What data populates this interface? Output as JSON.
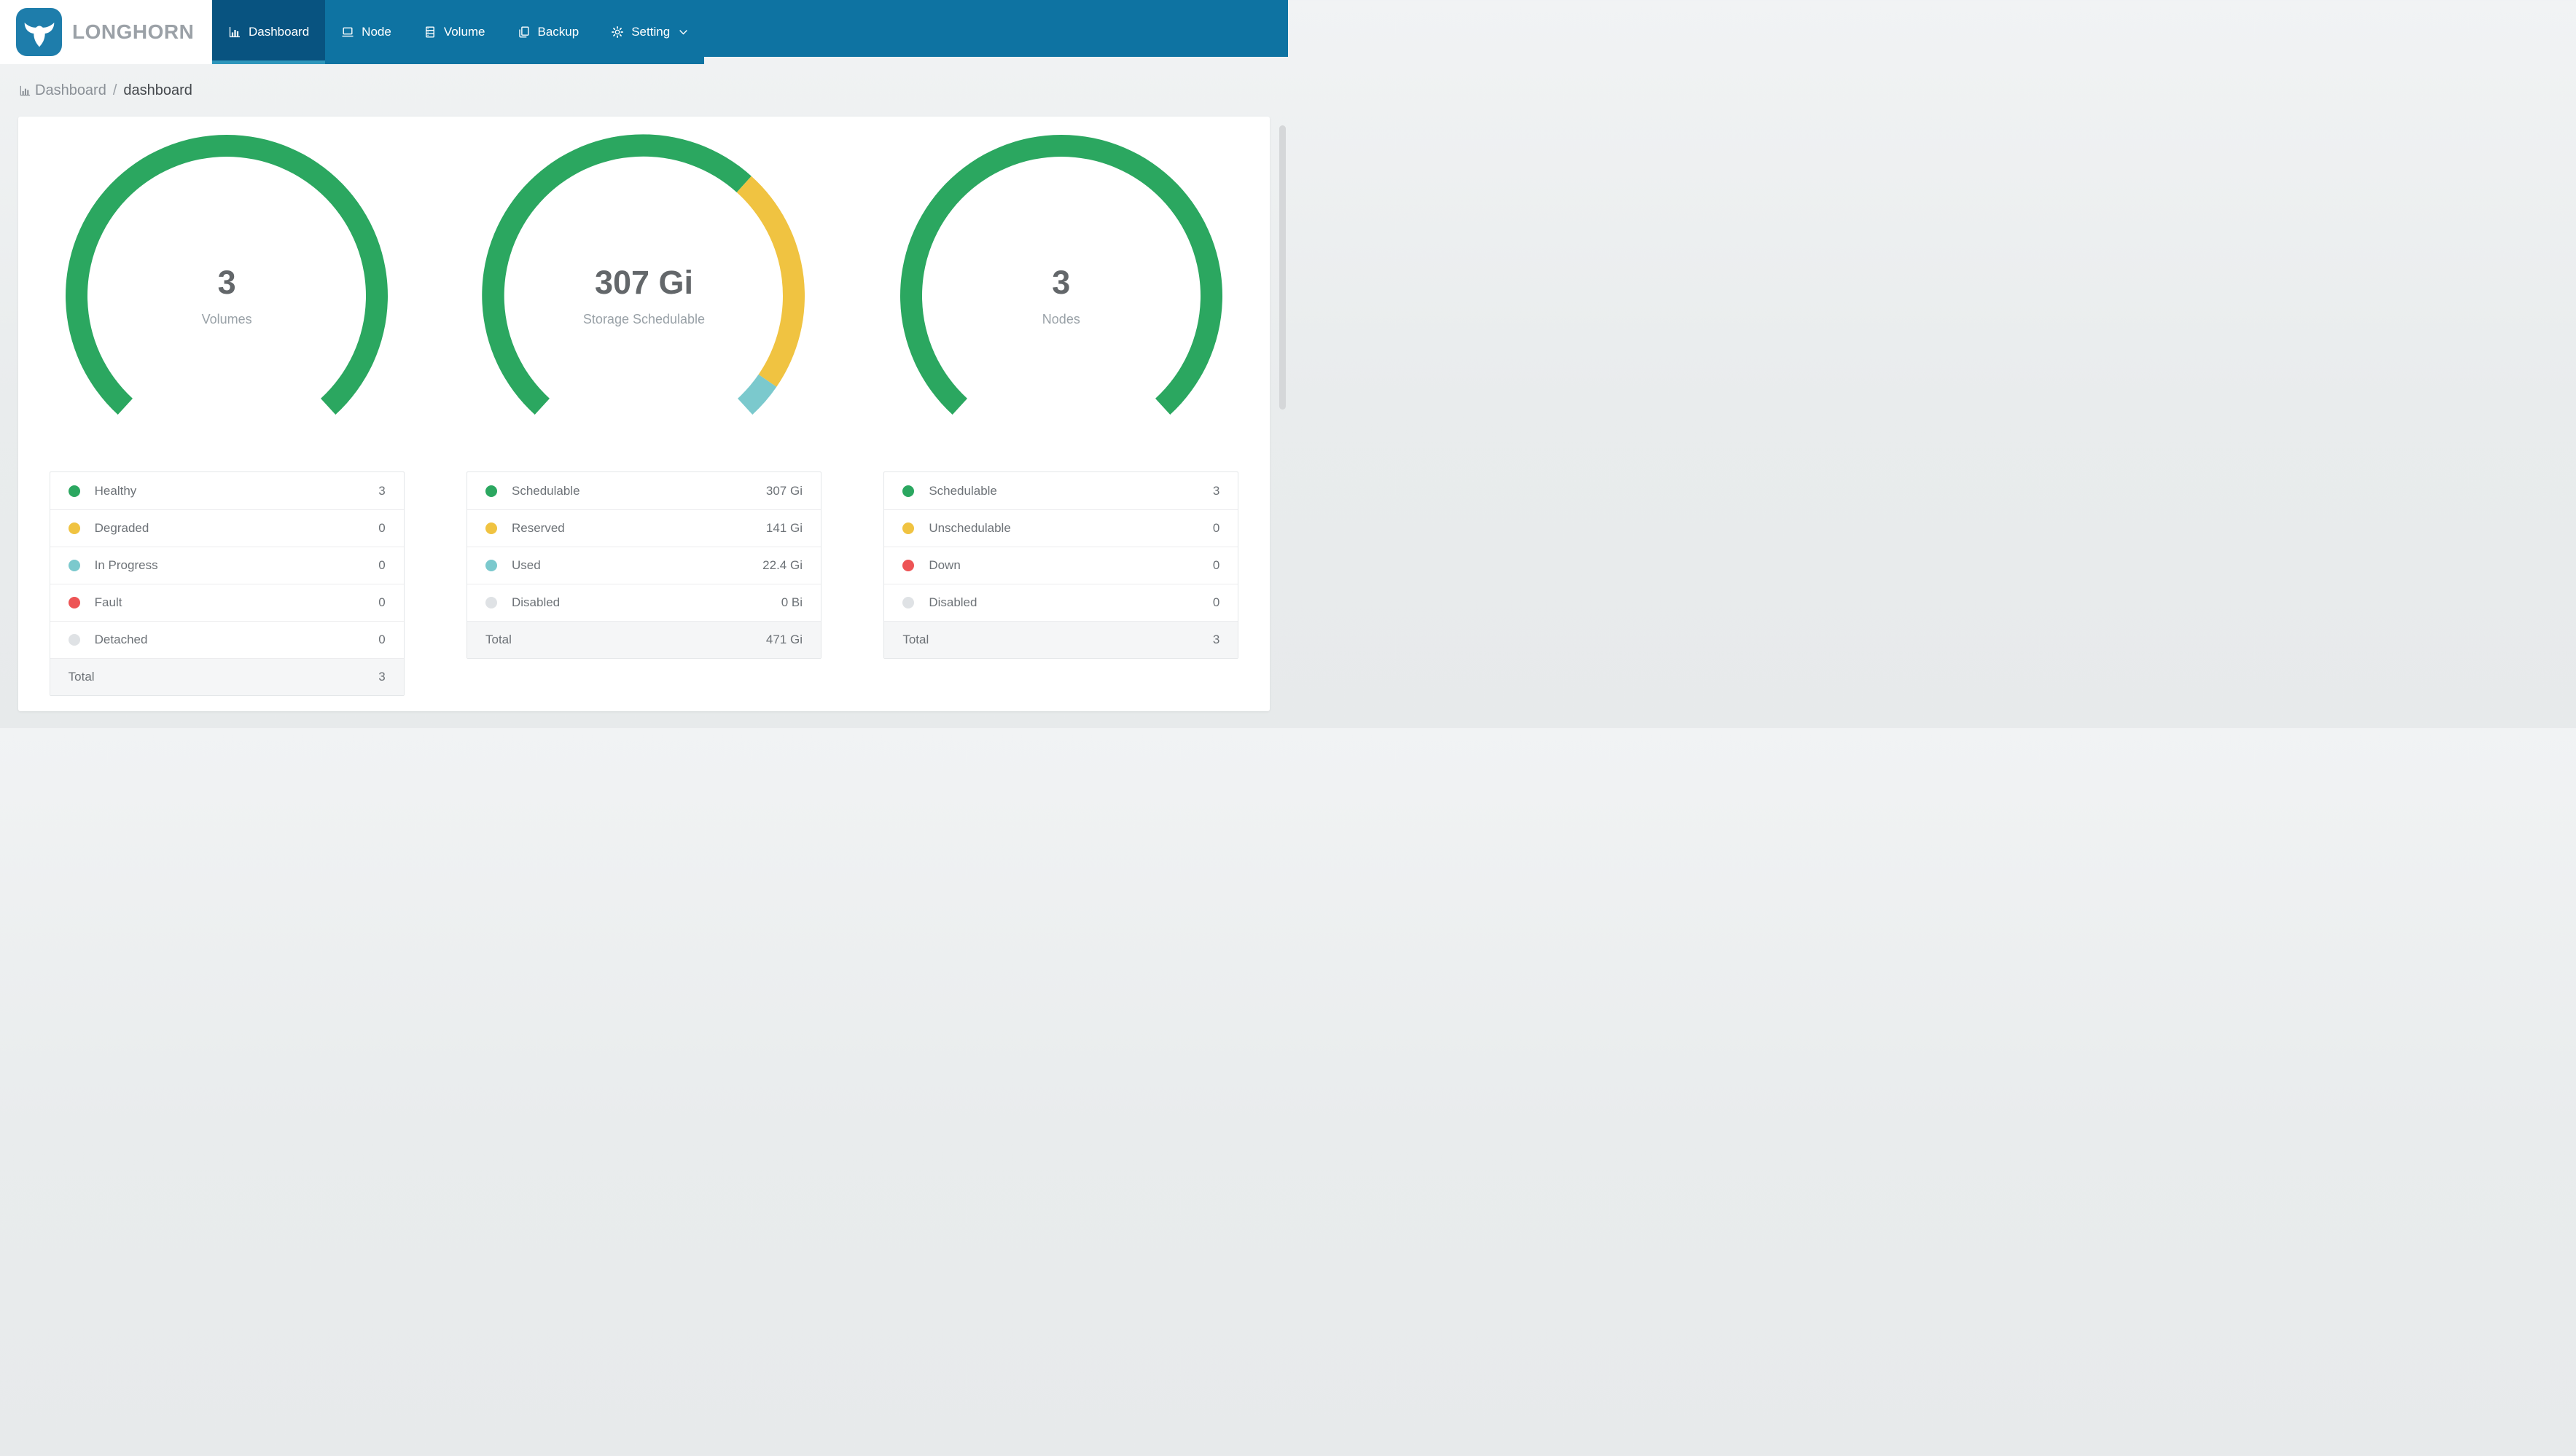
{
  "header": {
    "logo_text": "LONGHORN",
    "nav": [
      {
        "id": "dashboard",
        "label": "Dashboard",
        "icon": "bar-chart-icon",
        "active": true
      },
      {
        "id": "node",
        "label": "Node",
        "icon": "laptop-icon",
        "active": false
      },
      {
        "id": "volume",
        "label": "Volume",
        "icon": "database-icon",
        "active": false
      },
      {
        "id": "backup",
        "label": "Backup",
        "icon": "copy-icon",
        "active": false
      },
      {
        "id": "setting",
        "label": "Setting",
        "icon": "gear-icon",
        "active": false,
        "has_caret": true
      }
    ]
  },
  "breadcrumb": {
    "root": "Dashboard",
    "separator": "/",
    "current": "dashboard"
  },
  "colors": {
    "nav_bar": "#0e73a2",
    "nav_active_tab": "#085380",
    "nav_active_underline": "#2e96bb",
    "logo_badge": "#1e7dab",
    "green": "#2ba760",
    "yellow": "#f0c341",
    "teal": "#7bc9cd",
    "red": "#ed5455",
    "gray": "#dfe2e5"
  },
  "chart_data": [
    {
      "type": "pie",
      "variant": "gauge-donut",
      "title": "Volumes",
      "center_value": "3",
      "center_label": "Volumes",
      "start_angle": 222.5,
      "sweep": 275,
      "gap_position": "bottom",
      "segments": [
        {
          "label": "Healthy",
          "value": 3,
          "display": "3",
          "color": "#2ba760"
        },
        {
          "label": "Degraded",
          "value": 0,
          "display": "0",
          "color": "#f0c341"
        },
        {
          "label": "In Progress",
          "value": 0,
          "display": "0",
          "color": "#7bc9cd"
        },
        {
          "label": "Fault",
          "value": 0,
          "display": "0",
          "color": "#ed5455"
        },
        {
          "label": "Detached",
          "value": 0,
          "display": "0",
          "color": "#dfe2e5"
        }
      ],
      "total": {
        "label": "Total",
        "display": "3"
      }
    },
    {
      "type": "pie",
      "variant": "gauge-donut",
      "title": "Storage Schedulable",
      "center_value": "307 Gi",
      "center_label": "Storage Schedulable",
      "start_angle": 222.5,
      "sweep": 275,
      "gap_position": "bottom",
      "segments": [
        {
          "label": "Schedulable",
          "value": 307,
          "display": "307 Gi",
          "color": "#2ba760"
        },
        {
          "label": "Reserved",
          "value": 141,
          "display": "141 Gi",
          "color": "#f0c341"
        },
        {
          "label": "Used",
          "value": 22.4,
          "display": "22.4 Gi",
          "color": "#7bc9cd"
        },
        {
          "label": "Disabled",
          "value": 0,
          "display": "0 Bi",
          "color": "#dfe2e5"
        }
      ],
      "total": {
        "label": "Total",
        "display": "471 Gi"
      }
    },
    {
      "type": "pie",
      "variant": "gauge-donut",
      "title": "Nodes",
      "center_value": "3",
      "center_label": "Nodes",
      "start_angle": 222.5,
      "sweep": 275,
      "gap_position": "bottom",
      "segments": [
        {
          "label": "Schedulable",
          "value": 3,
          "display": "3",
          "color": "#2ba760"
        },
        {
          "label": "Unschedulable",
          "value": 0,
          "display": "0",
          "color": "#f0c341"
        },
        {
          "label": "Down",
          "value": 0,
          "display": "0",
          "color": "#ed5455"
        },
        {
          "label": "Disabled",
          "value": 0,
          "display": "0",
          "color": "#dfe2e5"
        }
      ],
      "total": {
        "label": "Total",
        "display": "3"
      }
    }
  ]
}
